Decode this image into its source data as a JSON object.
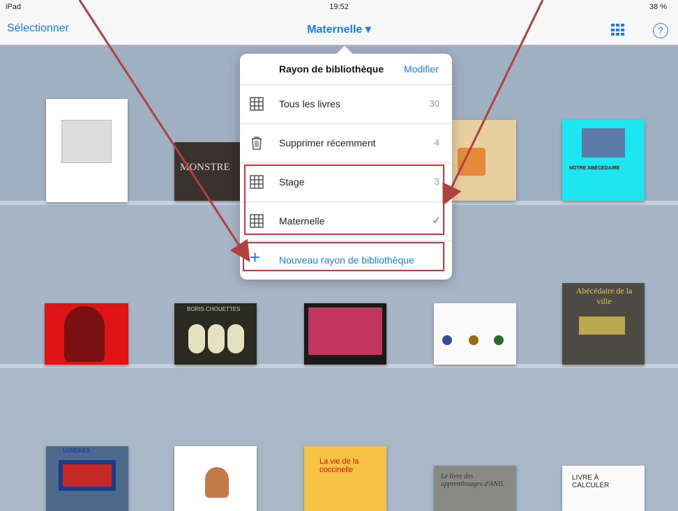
{
  "status": {
    "carrier": "iPad",
    "time": "19:52",
    "battery": "38 %"
  },
  "nav": {
    "select_label": "Sélectionner",
    "title": "Maternelle ▾",
    "grid_icon": "grid-icon",
    "help": "?"
  },
  "popover": {
    "title": "Rayon de bibliothèque",
    "edit_label": "Modifier",
    "rows": [
      {
        "label": "Tous les livres",
        "count": "30",
        "icon": "grid-icon"
      },
      {
        "label": "Supprimer récemment",
        "count": "4",
        "icon": "trash-icon"
      },
      {
        "label": "Stage",
        "count": "3",
        "icon": "grid-icon"
      },
      {
        "label": "Maternelle",
        "check": "✓",
        "icon": "grid-icon"
      }
    ],
    "new_shelf": "Nouveau rayon de bibliothèque"
  },
  "books": {
    "monster": "MONSTRE",
    "abecedaire_title": "NOTRE ABÉCÉDAIRE",
    "owls_title": "BORIS CHOUETTES",
    "abecedaire_ville": "Abécédaire de la ville",
    "coccinelle": "La vie de la coccinelle",
    "livre_calculer": "LIVRE À CALCULER",
    "anil": "Le livre des apprentissages d'ANIL",
    "london": "LONDRES"
  },
  "colors": {
    "accent": "#1a7cf5",
    "highlight": "#d9313a",
    "arrow": "#b0413e"
  }
}
